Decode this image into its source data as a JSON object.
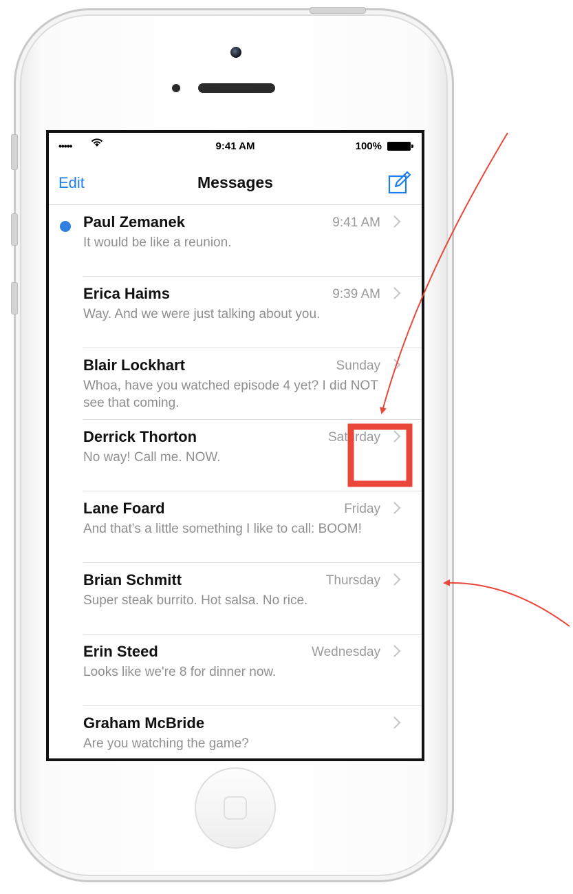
{
  "status_bar": {
    "signal": "•••••",
    "time": "9:41 AM",
    "battery": "100%"
  },
  "nav": {
    "edit_label": "Edit",
    "title": "Messages"
  },
  "conversations": [
    {
      "name": "Paul Zemanek",
      "time": "9:41 AM",
      "preview": "It would be like a reunion.",
      "unread": true
    },
    {
      "name": "Erica Haims",
      "time": "9:39 AM",
      "preview": "Way. And we were just talking about you.",
      "unread": false
    },
    {
      "name": "Blair Lockhart",
      "time": "Sunday",
      "preview": "Whoa, have you watched episode 4 yet? I did NOT see that coming.",
      "unread": false
    },
    {
      "name": "Derrick Thorton",
      "time": "Saturday",
      "preview": "No way! Call me. NOW.",
      "unread": false
    },
    {
      "name": "Lane Foard",
      "time": "Friday",
      "preview": "And that's a little something I like to call: BOOM!",
      "unread": false
    },
    {
      "name": "Brian Schmitt",
      "time": "Thursday",
      "preview": "Super steak burrito. Hot salsa. No rice.",
      "unread": false
    },
    {
      "name": "Erin Steed",
      "time": "Wednesday",
      "preview": "Looks like we're 8 for dinner now.",
      "unread": false
    },
    {
      "name": "Graham McBride",
      "time": "",
      "preview": "Are you watching the game?",
      "unread": false
    }
  ],
  "colors": {
    "accent": "#1e7ef0",
    "unread_dot": "#2f7fe3",
    "annotation": "#e8473a"
  },
  "icons": {
    "wifi": "wifi-icon",
    "compose": "compose-icon",
    "chevron": "chevron-right-icon",
    "battery": "battery-icon"
  }
}
